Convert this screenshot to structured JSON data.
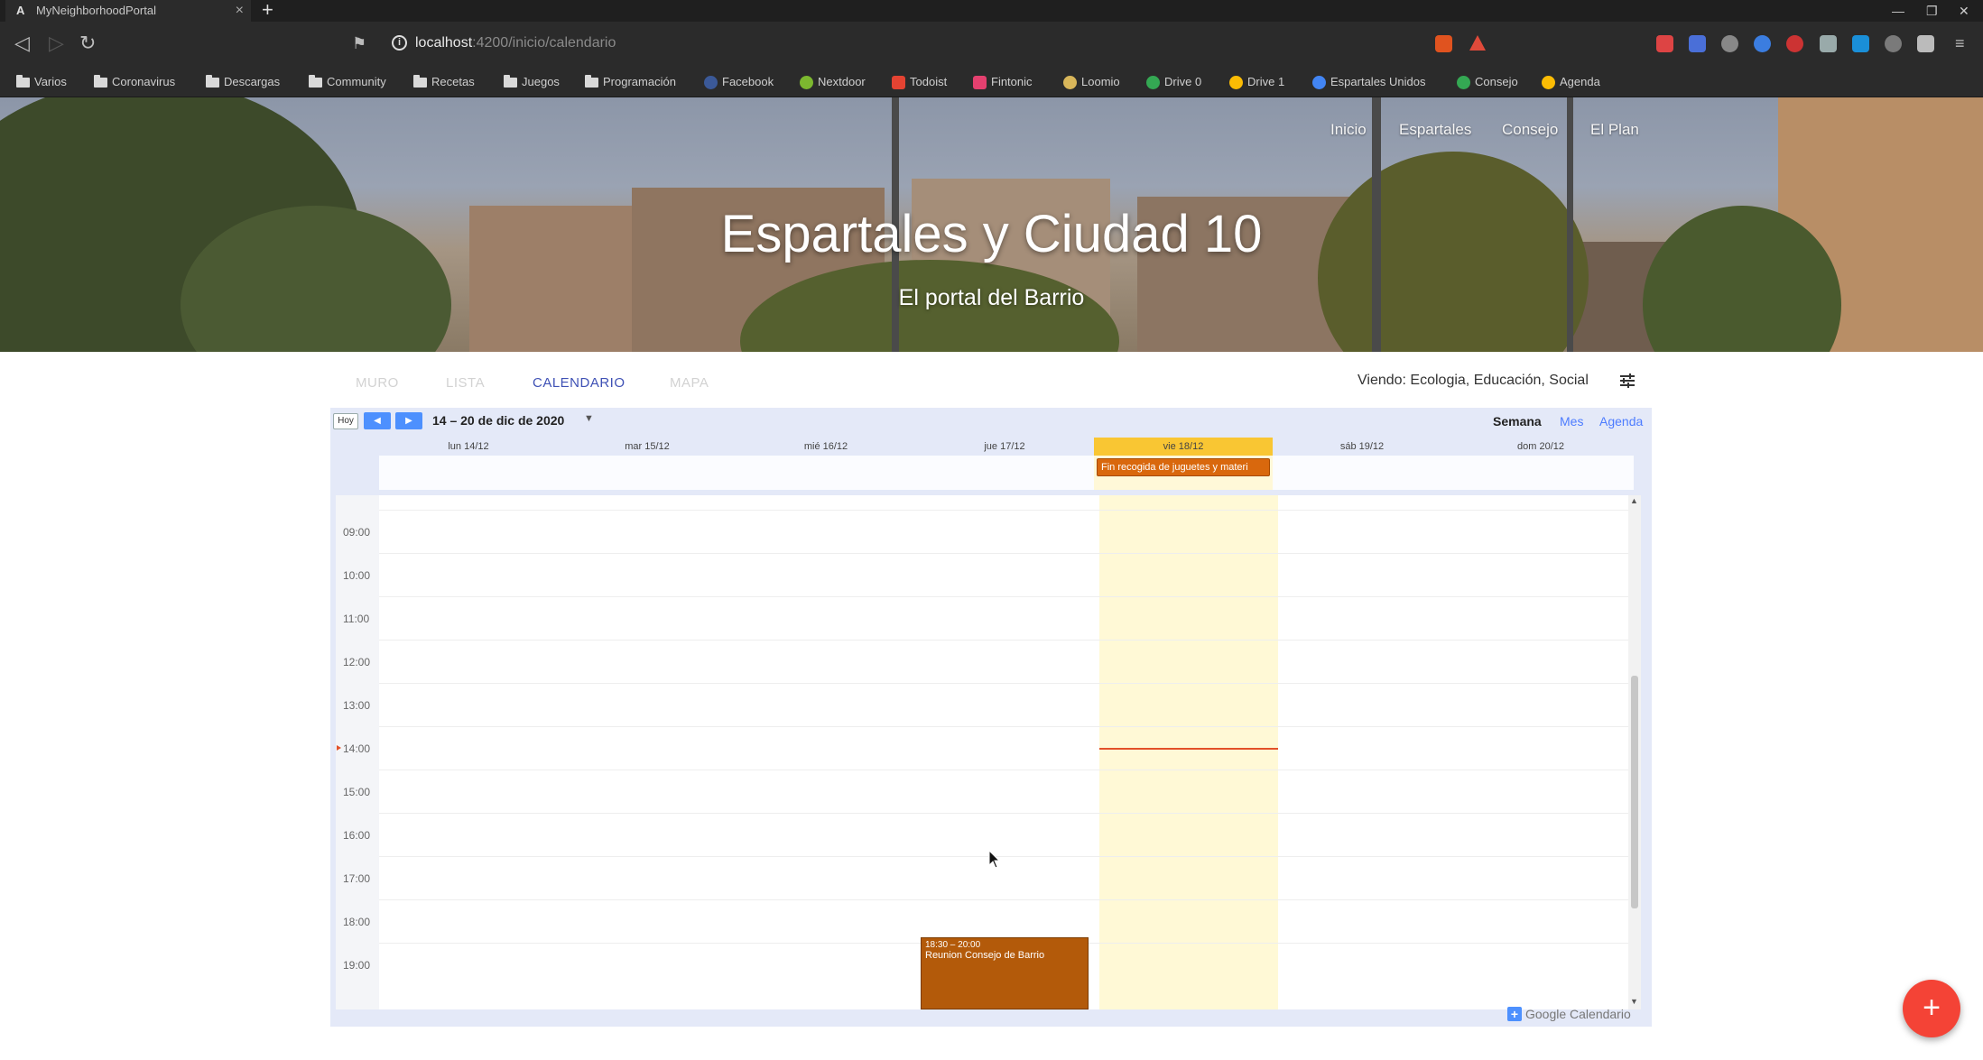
{
  "browser": {
    "tab_title": "MyNeighborhoodPortal",
    "tab_favicon": "A",
    "url_host": "localhost",
    "url_path": ":4200/inicio/calendario",
    "bookmarks": [
      "Varios",
      "Coronavirus",
      "Descargas",
      "Community",
      "Recetas",
      "Juegos",
      "Programación",
      "Facebook",
      "Nextdoor",
      "Todoist",
      "Fintonic",
      "Loomio",
      "Drive 0",
      "Drive 1",
      "Espartales Unidos",
      "Consejo",
      "Agenda"
    ]
  },
  "hero": {
    "nav": [
      "Inicio",
      "Espartales",
      "Consejo",
      "El Plan"
    ],
    "title": "Espartales y Ciudad 10",
    "subtitle": "El portal del Barrio"
  },
  "views": {
    "tabs": [
      "MURO",
      "LISTA",
      "CALENDARIO",
      "MAPA"
    ],
    "active": "CALENDARIO",
    "viewing": "Viendo: Ecologia, Educación, Social"
  },
  "calendar": {
    "today_button": "Hoy",
    "prev": "◀",
    "next": "▶",
    "range": "14 – 20 de dic de 2020",
    "modes": [
      "Semana",
      "Mes",
      "Agenda"
    ],
    "selected_mode": "Semana",
    "days": [
      "lun 14/12",
      "mar 15/12",
      "mié 16/12",
      "jue 17/12",
      "vie 18/12",
      "sáb 19/12",
      "dom 20/12"
    ],
    "today_index": 4,
    "hours": [
      "09:00",
      "10:00",
      "11:00",
      "12:00",
      "13:00",
      "14:00",
      "15:00",
      "16:00",
      "17:00",
      "18:00",
      "19:00"
    ],
    "allday_event": "Fin recogida de juguetes y materi",
    "timed_event": {
      "time": "18:30 – 20:00",
      "title": "Reunion Consejo de Barrio"
    },
    "branding": "Google Calendario"
  },
  "colors": {
    "accent": "#3f51b5",
    "today": "#f9c633",
    "event": "#b35a0a",
    "fab": "#f44336"
  }
}
